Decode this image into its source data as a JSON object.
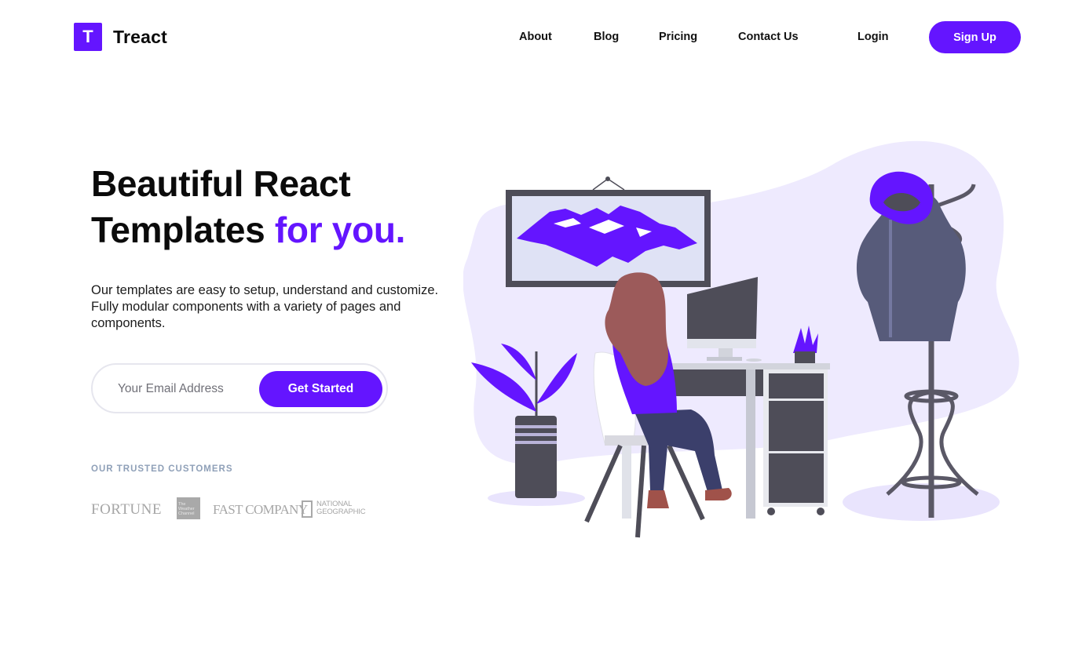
{
  "brand": {
    "mark": "T",
    "name": "Treact"
  },
  "nav": {
    "links": [
      "About",
      "Blog",
      "Pricing",
      "Contact Us"
    ],
    "login": "Login",
    "signup": "Sign Up"
  },
  "hero": {
    "headline_main": "Beautiful React Templates",
    "headline_accent": "for you.",
    "description": "Our templates are easy to setup, understand and customize. Fully modular components with a variety of pages and components.",
    "email_placeholder": "Your Email Address",
    "cta": "Get Started"
  },
  "customers": {
    "label": "OUR TRUSTED CUSTOMERS",
    "logos": {
      "fortune": "FORTUNE",
      "weather": "The Weather Channel",
      "fastco": "FAST COMPANY",
      "natgeo": "NATIONAL\nGEOGRAPHIC"
    }
  },
  "colors": {
    "primary": "#6415ff",
    "blob": "#eeeafe",
    "dark": "#4e4d58"
  },
  "illustration": {
    "name": "woman-at-desk-illustration"
  }
}
